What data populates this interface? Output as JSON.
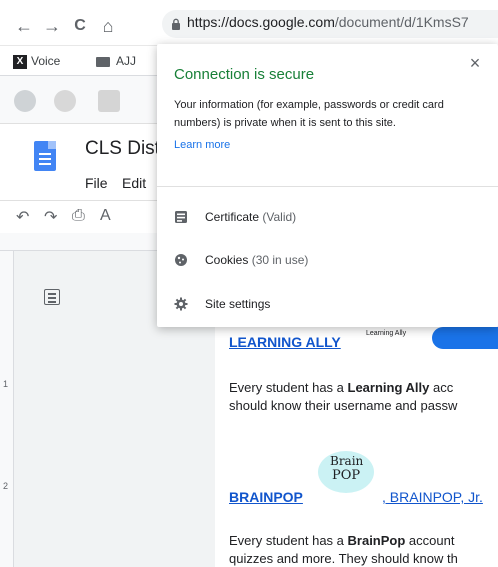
{
  "browser": {
    "nav": {
      "back": "←",
      "forward": "→",
      "reload": "C",
      "home": "⌂"
    },
    "url": {
      "domain": "https://docs.google.com",
      "path": "/document/d/1KmsS7"
    }
  },
  "bookmarks": [
    {
      "label": "Voice"
    },
    {
      "label": "AJJ"
    }
  ],
  "doc": {
    "title": "CLS Dist",
    "menu": {
      "file": "File",
      "edit": "Edit"
    }
  },
  "document_content": {
    "learning_ally_heading": "LEARNING ALLY",
    "learning_ally_logo_text": "Learning Ally",
    "learning_ally_line1_prefix": "Every student has a ",
    "learning_ally_line1_bold": "Learning Ally",
    "learning_ally_line1_suffix": " acc",
    "learning_ally_line2": "should know their username and passw",
    "brainpop_heading": "BRAINPOP",
    "brainpop_logo_top": "Brain",
    "brainpop_logo_bottom": "POP",
    "brainpop_jr_link": ", BRAINPOP, Jr.",
    "brainpop_line1_prefix": "Every student has a ",
    "brainpop_line1_bold": "BrainPop",
    "brainpop_line1_suffix": " account",
    "brainpop_line2": "quizzes and more. They should know th"
  },
  "popup": {
    "title": "Connection is secure",
    "close": "×",
    "body": "Your information (for example, passwords or credit card numbers) is private when it is sent to this site.",
    "learn_more": "Learn more",
    "rows": [
      {
        "label": "Certificate",
        "suffix": " (Valid)",
        "icon": "certificate-icon"
      },
      {
        "label": "Cookies",
        "suffix": " (30 in use)",
        "icon": "cookie-icon"
      },
      {
        "label": "Site settings",
        "suffix": "",
        "icon": "gear-icon"
      }
    ]
  },
  "ruler_numbers": [
    "1",
    "2"
  ],
  "colors": {
    "secure_green": "#188038",
    "link_blue": "#1155cc",
    "docs_blue": "#4285f4"
  }
}
